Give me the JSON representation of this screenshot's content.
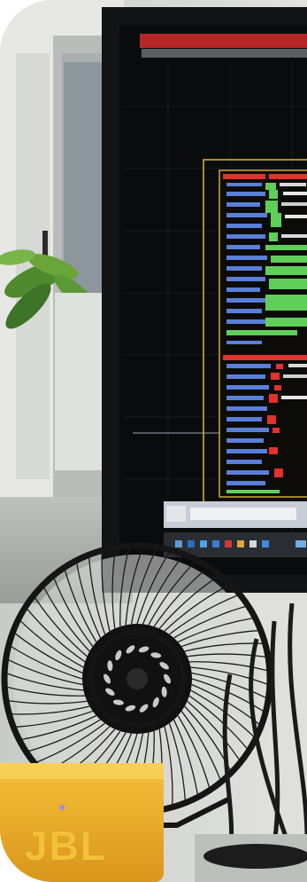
{
  "scene": {
    "description_hidden": false,
    "speaker_brand": "JBL",
    "colors": {
      "wall": "#cfd2ce",
      "monitor_bezel": "#121314",
      "screen_bg": "#0b0c0d",
      "pcb_board_line": "#e0b83a",
      "pcb_red": "#e2322b",
      "pcb_green": "#5fcf5a",
      "pcb_blue": "#5a7fd8",
      "taskbar": "#c8ccd4",
      "speaker": "#f2b52c",
      "fan": "#151515"
    }
  }
}
